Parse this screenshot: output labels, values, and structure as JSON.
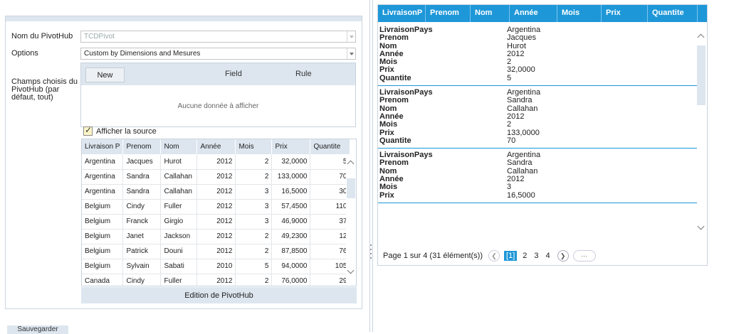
{
  "form": {
    "pivothub_label": "Nom du PivotHub",
    "pivothub_value": "TCDPivot",
    "options_label": "Options",
    "options_value": "Custom by Dimensions and Mesures",
    "fields_label": "Champs choisis du PivotHub (par défaut, tout)"
  },
  "fields_grid": {
    "new_label": "New",
    "col_field": "Field",
    "col_rule": "Rule",
    "empty_text": "Aucune donnée à afficher"
  },
  "show_source": {
    "label": "Afficher la source",
    "checked": true
  },
  "source_table": {
    "columns": [
      "Livraison P",
      "Prenom",
      "Nom",
      "Année",
      "Mois",
      "Prix",
      "Quantite"
    ],
    "rows": [
      [
        "Argentina",
        "Jacques",
        "Hurot",
        "2012",
        "2",
        "32,0000",
        "5"
      ],
      [
        "Argentina",
        "Sandra",
        "Callahan",
        "2012",
        "2",
        "133,0000",
        "70"
      ],
      [
        "Argentina",
        "Sandra",
        "Callahan",
        "2012",
        "3",
        "16,5000",
        "30"
      ],
      [
        "Belgium",
        "Cindy",
        "Fuller",
        "2012",
        "3",
        "57,4500",
        "110"
      ],
      [
        "Belgium",
        "Franck",
        "Girgio",
        "2012",
        "3",
        "46,9000",
        "37"
      ],
      [
        "Belgium",
        "Janet",
        "Jackson",
        "2012",
        "2",
        "49,2300",
        "12"
      ],
      [
        "Belgium",
        "Patrick",
        "Douni",
        "2012",
        "2",
        "87,8500",
        "76"
      ],
      [
        "Belgium",
        "Sylvain",
        "Sabati",
        "2010",
        "5",
        "94,0000",
        "105"
      ],
      [
        "Canada",
        "Cindy",
        "Fuller",
        "2012",
        "2",
        "76,0000",
        "29"
      ]
    ]
  },
  "edit_label": "Edition de PivotHub",
  "bottom_button": "Sauvegarder",
  "cards_view": {
    "columns": [
      "LivraisonP",
      "Prenom",
      "Nom",
      "Année",
      "Mois",
      "Prix",
      "Quantite"
    ],
    "keys": [
      "LivraisonPays",
      "Prenom",
      "Nom",
      "Année",
      "Mois",
      "Prix",
      "Quantite"
    ],
    "records": [
      [
        "Argentina",
        "Jacques",
        "Hurot",
        "2012",
        "2",
        "32,0000",
        "5"
      ],
      [
        "Argentina",
        "Sandra",
        "Callahan",
        "2012",
        "2",
        "133,0000",
        "70"
      ],
      [
        "Argentina",
        "Sandra",
        "Callahan",
        "2012",
        "3",
        "16,5000",
        ""
      ]
    ]
  },
  "pager": {
    "info": "Page 1 sur 4 (31 élément(s))",
    "current": "[1]",
    "pages": [
      "2",
      "3",
      "4"
    ],
    "more": "···"
  },
  "colors": {
    "accent": "#1e97d8",
    "header_bg": "#dde6ef"
  }
}
